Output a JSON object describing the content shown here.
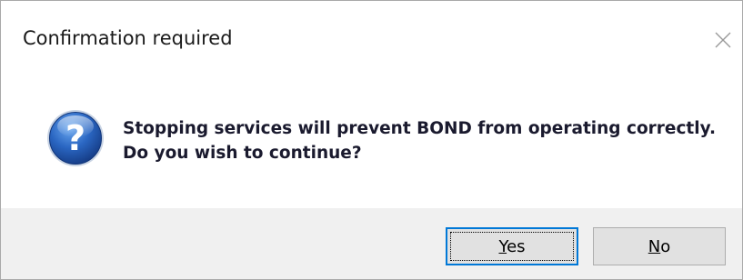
{
  "dialog": {
    "title": "Confirmation required",
    "close_icon": "close-icon",
    "icon": "question-icon",
    "message_line1": "Stopping services will prevent BOND from operating correctly.",
    "message_line2": "Do you wish to continue?"
  },
  "buttons": {
    "yes": {
      "mnemonic": "Y",
      "rest": "es"
    },
    "no": {
      "mnemonic": "N",
      "rest": "o"
    }
  },
  "colors": {
    "footer_bg": "#f0f0f0",
    "button_bg": "#e1e1e1",
    "default_button_border": "#0078d7",
    "icon_blue": "#1f5fb8"
  }
}
